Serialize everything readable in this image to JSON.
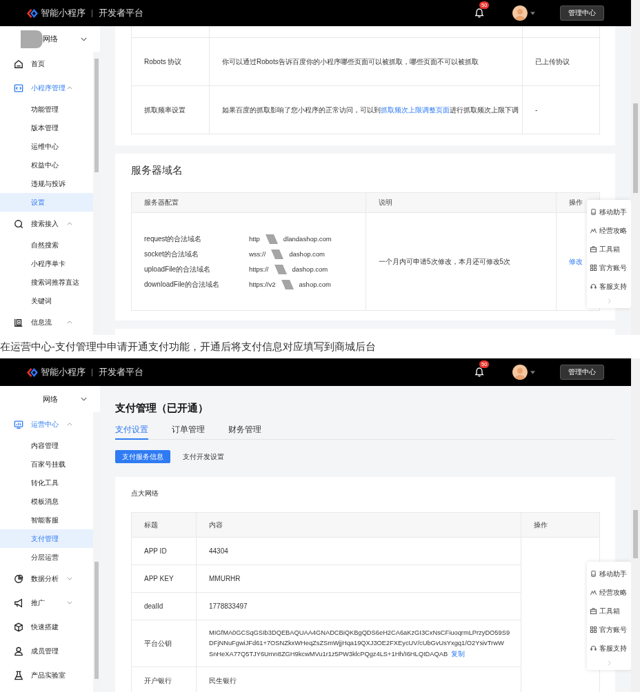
{
  "sections": [
    {
      "kind": "crawl",
      "header": {
        "brand": "智能小程序",
        "platform": "开发者平台",
        "notification_count": "50",
        "button": "管理中心"
      },
      "sidebar": {
        "account": "网络",
        "items": [
          {
            "kind": "link",
            "label": "首页",
            "selected": false
          },
          {
            "kind": "group",
            "label": "小程序管理",
            "expanded": true,
            "active": true
          },
          {
            "kind": "sub",
            "label": "功能管理",
            "selected": false
          },
          {
            "kind": "sub",
            "label": "版本管理",
            "selected": false
          },
          {
            "kind": "sub",
            "label": "运维中心",
            "selected": false
          },
          {
            "kind": "sub",
            "label": "权益中心",
            "selected": false
          },
          {
            "kind": "sub",
            "label": "违规与投诉",
            "selected": false
          },
          {
            "kind": "sub",
            "label": "设置",
            "selected": true
          },
          {
            "kind": "group",
            "label": "搜索接入",
            "expanded": true,
            "active": false
          },
          {
            "kind": "sub",
            "label": "自然搜索",
            "selected": false
          },
          {
            "kind": "sub",
            "label": "小程序单卡",
            "selected": false
          },
          {
            "kind": "sub",
            "label": "搜索词推荐直达",
            "selected": false
          },
          {
            "kind": "sub",
            "label": "关键词",
            "selected": false
          },
          {
            "kind": "group",
            "label": "信息流",
            "expanded": true,
            "active": false
          }
        ]
      },
      "rules_table": {
        "rows": [
          {
            "name": "Robots 协议",
            "description": "你可以通过Robots告诉百度你的小程序哪些页面可以被抓取，哪些页面不可以被抓取",
            "status": "已上传协议"
          },
          {
            "name": "抓取频率设置",
            "description": "如果百度的抓取影响了您小程序的正常访问，可以到",
            "link": "抓取频次上限调整页面",
            "description_end": "进行抓取频次上限下调",
            "status": "-"
          }
        ]
      },
      "server_domains": {
        "title": "服务器域名",
        "columns": [
          "服务器配置",
          "说明",
          "操作"
        ],
        "domains": [
          {
            "label": "request的合法域名",
            "prefix": "http",
            "suffix": "dlandashop.com"
          },
          {
            "label": "socket的合法域名",
            "prefix": "wss://",
            "suffix": "dashop.com"
          },
          {
            "label": "uploadFile的合法域名",
            "prefix": "https://",
            "suffix": "dashop.com"
          },
          {
            "label": "downloadFile的合法域名",
            "prefix": "https://v2",
            "suffix": "ashop.com"
          }
        ],
        "note": "一个月内可申请5次修改，本月还可修改5次",
        "action": "修改"
      },
      "helpers": [
        "移动助手",
        "经营攻略",
        "工具箱",
        "官方账号",
        "客服支持"
      ]
    },
    {
      "kind": "caption",
      "text": "在运营中心-支付管理中申请开通支付功能，开通后将支付信息对应填写到商城后台"
    },
    {
      "kind": "payment",
      "header": {
        "brand": "智能小程序",
        "platform": "开发者平台",
        "notification_count": "50",
        "button": "管理中心"
      },
      "sidebar": {
        "account": "网络",
        "items": [
          {
            "kind": "group",
            "label": "运营中心",
            "expanded": true,
            "active": true
          },
          {
            "kind": "sub",
            "label": "内容管理",
            "selected": false
          },
          {
            "kind": "sub",
            "label": "百家号挂载",
            "selected": false
          },
          {
            "kind": "sub",
            "label": "转化工具",
            "selected": false
          },
          {
            "kind": "sub",
            "label": "模板消息",
            "selected": false
          },
          {
            "kind": "sub",
            "label": "智能客服",
            "selected": false
          },
          {
            "kind": "sub",
            "label": "支付管理",
            "selected": true
          },
          {
            "kind": "sub",
            "label": "分层运营",
            "selected": false
          },
          {
            "kind": "group",
            "label": "数据分析",
            "expanded": false,
            "active": false
          },
          {
            "kind": "group",
            "label": "推广",
            "expanded": false,
            "active": false
          },
          {
            "kind": "link",
            "label": "快速搭建",
            "selected": false
          },
          {
            "kind": "link",
            "label": "成员管理",
            "selected": false
          },
          {
            "kind": "link",
            "label": "产品实验室",
            "selected": false
          }
        ]
      },
      "page_title": "支付管理（已开通）",
      "tabs": [
        {
          "label": "支付设置",
          "selected": true
        },
        {
          "label": "订单管理",
          "selected": false
        },
        {
          "label": "财务管理",
          "selected": false
        }
      ],
      "subtabs": [
        {
          "label": "支付服务信息",
          "selected": true
        },
        {
          "label": "支付开发设置",
          "selected": false
        }
      ],
      "info_card": {
        "title": "点大网络",
        "columns": [
          "标题",
          "内容",
          "操作"
        ],
        "rows": [
          {
            "label": "APP ID",
            "lines": [
              "44304"
            ]
          },
          {
            "label": "APP KEY",
            "lines": [
              "MMURHR"
            ]
          },
          {
            "label": "dealId",
            "lines": [
              "1778833497"
            ]
          },
          {
            "label": "平台公钥",
            "lines": [
              "MIGfMA0GCSqGSIb3DQEBAQUAA4GNADCBiQKBgQDS6eH2CA6aKzGI3CxNsCFiuoqrmLPrzyDO59S9",
              "DFjNNuFgwiJFd61+7OSNZkxWHeqZsZSmWjjHqa19QXJ3OE2FXEycUV/cUbGvUsYxgq1/O2YsivTrwW",
              "SnHeXA77Q5TJY6Umn8ZGH9kcwMVu1r1z5PW3klcPQgz4LS+1Hh/I6HLQIDAQAB"
            ],
            "copy": "复制"
          },
          {
            "label": "开户银行",
            "lines": [
              "民生银行"
            ]
          }
        ]
      },
      "helpers": [
        "移动助手",
        "经营攻略",
        "工具箱",
        "官方账号",
        "客服支持"
      ]
    }
  ]
}
